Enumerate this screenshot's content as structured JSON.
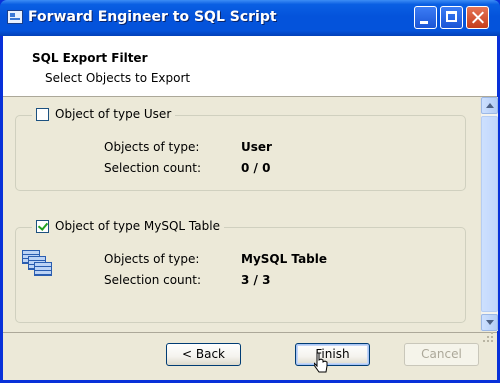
{
  "window": {
    "title": "Forward Engineer to SQL Script",
    "icon": "app-window-icon"
  },
  "header": {
    "title": "SQL Export Filter",
    "subtitle": "Select Objects to Export"
  },
  "groups": [
    {
      "checkbox_label": "Object of type User",
      "checked": false,
      "objects_of_type_label": "Objects of type:",
      "objects_of_type_value": "User",
      "selection_count_label": "Selection count:",
      "selection_count_value": "0 / 0"
    },
    {
      "checkbox_label": "Object of type MySQL Table",
      "checked": true,
      "icon": "table-icon",
      "objects_of_type_label": "Objects of type:",
      "objects_of_type_value": "MySQL Table",
      "selection_count_label": "Selection count:",
      "selection_count_value": "3 / 3"
    }
  ],
  "buttons": {
    "back": "< Back",
    "finish": "Finish",
    "cancel": "Cancel"
  }
}
